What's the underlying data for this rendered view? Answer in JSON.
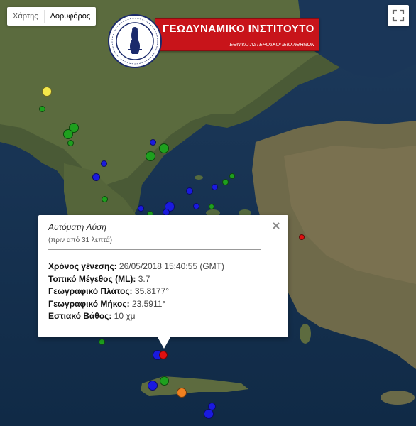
{
  "map_type": {
    "options": [
      "Χάρτης",
      "Δορυφόρος"
    ],
    "selected": "Δορυφόρος"
  },
  "fullscreen": {
    "icon": "fullscreen-icon"
  },
  "logo": {
    "institute": "ΓΕΩΔΥΝΑΜΙΚΟ ΙΝΣΤΙΤΟΥΤΟ",
    "subtitle": "ΕΘΝΙΚΟ ΑΣΤΕΡΟΣΚΟΠΕΙΟ ΑΘΗΝΩΝ",
    "seal_text": "ΕΘΝΙΚΟ ΑΣΤΕΡΟΣΚΟΠΕΙΟ ΑΘΗΝΩΝ · NATIONAL OBSERVATORY OF ATHENS"
  },
  "marker_colors": {
    "yellow": "#f4e84a",
    "green": "#1ea01e",
    "blue": "#1a1ae0",
    "red": "#e01010",
    "orange": "#f08020"
  },
  "popup": {
    "title": "Αυτόματη Λύση",
    "ago": "(πριν από 31 λεπτά)",
    "close_icon": "close-icon",
    "rows": [
      {
        "label": "Χρόνος γένεσης:",
        "value": " 26/05/2018  15:40:55 (GMT)"
      },
      {
        "label": "Τοπικό Μέγεθος (ML):",
        "value": " 3.7"
      },
      {
        "label": "Γεωγραφικό Πλάτος:",
        "value": " 35.8177°"
      },
      {
        "label": "Γεωγραφικό Μήκος:",
        "value": " 23.5911°"
      },
      {
        "label": "Εστιακό Βάθος:",
        "value": " 10 χμ"
      }
    ]
  }
}
